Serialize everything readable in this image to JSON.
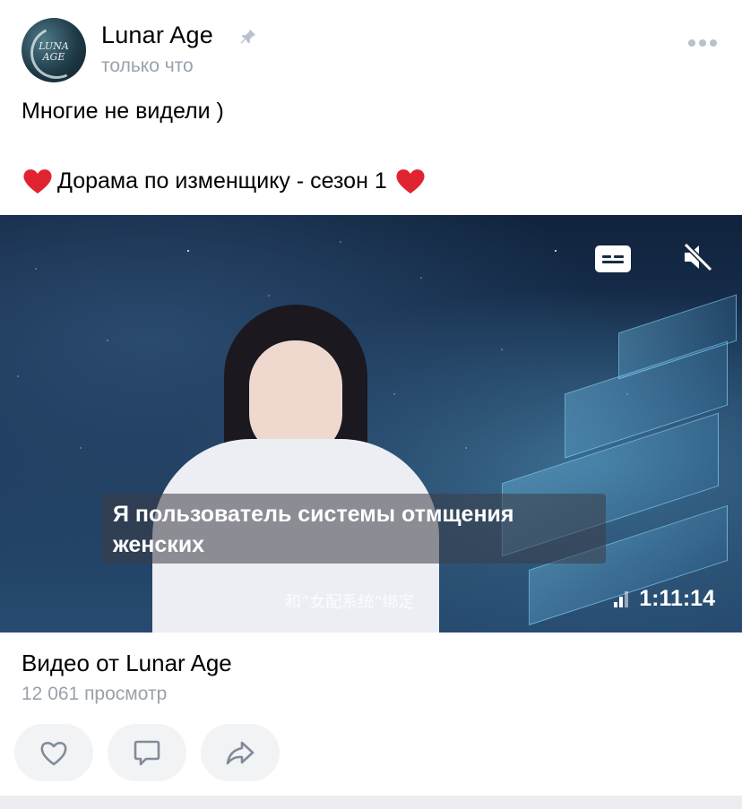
{
  "post": {
    "author": "Lunar Age",
    "time": "только что",
    "avatar_text": "LUNA AGE",
    "text_line1": "Многие не видели )",
    "text_line2": "Дорама по изменщику - сезон 1",
    "icons": {
      "pin": "pin-icon",
      "more": "more-dots-icon",
      "heart_emoji": "red-heart-emoji"
    }
  },
  "video": {
    "subtitle": "Я пользователь системы отмщения женских",
    "hardsub": "和“女配系统”绑定",
    "duration": "1:11:14",
    "title": "Видео от Lunar Age",
    "views": "12 061 просмотр",
    "icons": {
      "captions": "captions-icon",
      "mute": "muted-speaker-icon",
      "quality": "signal-bars-icon"
    }
  },
  "actions": [
    {
      "name": "like",
      "icon": "heart-outline-icon"
    },
    {
      "name": "comment",
      "icon": "comment-bubble-icon"
    },
    {
      "name": "share",
      "icon": "share-arrow-icon"
    }
  ],
  "colors": {
    "secondary_text": "#99a2ad",
    "action_bg": "#f2f3f5",
    "icon": "#818c99",
    "heart": "#e0242f"
  }
}
